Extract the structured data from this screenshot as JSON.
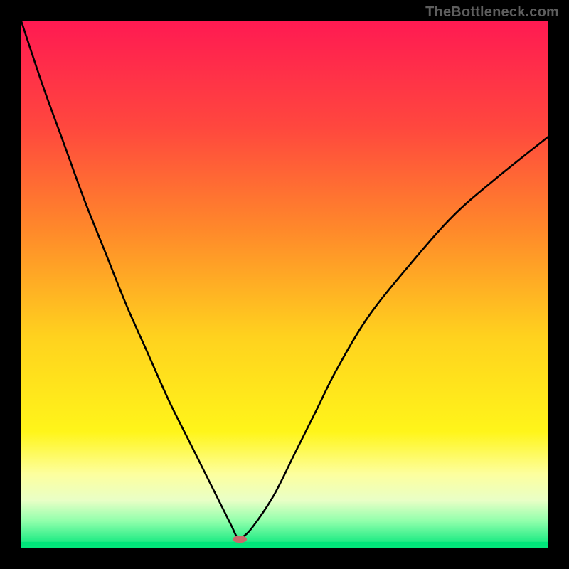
{
  "watermark": "TheBottleneck.com",
  "chart_data": {
    "type": "line",
    "title": "",
    "xlabel": "",
    "ylabel": "",
    "xlim": [
      0,
      100
    ],
    "ylim": [
      0,
      100
    ],
    "grid": false,
    "legend": false,
    "gradient_stops": [
      {
        "offset": 0,
        "color": "#ff1a52"
      },
      {
        "offset": 20,
        "color": "#ff473e"
      },
      {
        "offset": 40,
        "color": "#ff8a2a"
      },
      {
        "offset": 60,
        "color": "#ffd21e"
      },
      {
        "offset": 78,
        "color": "#fff51a"
      },
      {
        "offset": 86,
        "color": "#fdff9e"
      },
      {
        "offset": 91,
        "color": "#e9ffc6"
      },
      {
        "offset": 95,
        "color": "#8fffab"
      },
      {
        "offset": 100,
        "color": "#00e67a"
      }
    ],
    "series": [
      {
        "name": "bottleneck-curve",
        "x": [
          0,
          4,
          8,
          12,
          16,
          20,
          24,
          28,
          32,
          36,
          38,
          40,
          41,
          42,
          44,
          48,
          52,
          56,
          60,
          66,
          74,
          82,
          90,
          100
        ],
        "y": [
          100,
          88,
          77,
          66,
          56,
          46,
          37,
          28,
          20,
          12,
          8,
          4,
          2,
          2,
          4,
          10,
          18,
          26,
          34,
          44,
          54,
          63,
          70,
          78
        ]
      }
    ],
    "marker": {
      "name": "min-point",
      "x": 41.5,
      "y": 1.6,
      "color": "#c96a6a",
      "rx": 10,
      "ry": 5
    },
    "green_baseline_y": 0.7
  }
}
